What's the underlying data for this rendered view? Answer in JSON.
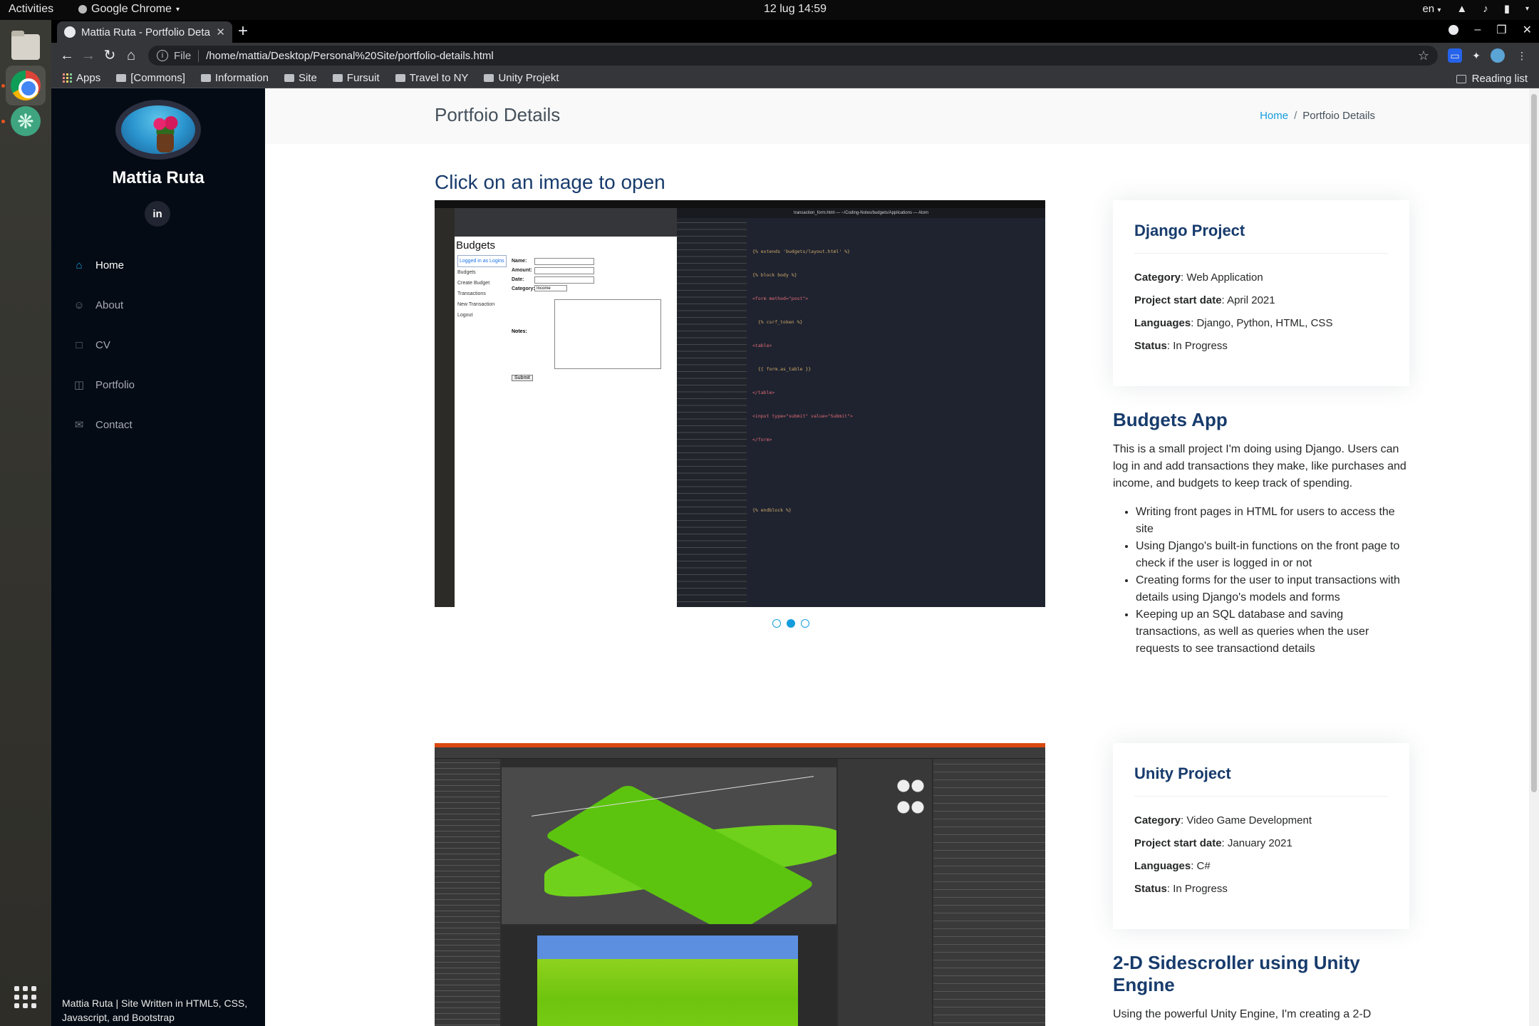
{
  "system": {
    "activities": "Activities",
    "app_name": "Google Chrome",
    "clock": "12 lug  14:59",
    "lang": "en"
  },
  "browser": {
    "tab_title": "Mattia Ruta - Portfolio Details",
    "scheme": "File",
    "url": "/home/mattia/Desktop/Personal%20Site/portfolio-details.html",
    "bookmarks": [
      "Apps",
      "[Commons]",
      "Information",
      "Site",
      "Fursuit",
      "Travel to NY",
      "Unity Projekt"
    ],
    "reading_list": "Reading list"
  },
  "sidebar": {
    "name": "Mattia Ruta",
    "social": "in",
    "nav": [
      "Home",
      "About",
      "CV",
      "Portfolio",
      "Contact"
    ],
    "footer": "Mattia Ruta | Site Written in HTML5, CSS, Javascript, and Bootstrap"
  },
  "breadcrumbs": {
    "title": "Portfoio Details",
    "home": "Home",
    "sep": "/",
    "current": "Portfoio Details"
  },
  "content": {
    "hint": "Click on an image to open",
    "slider_count": 3,
    "slider_active_index": 1
  },
  "projects": [
    {
      "card_title": "Django Project",
      "category_label": "Category",
      "category": "Web Application",
      "date_label": "Project start date",
      "date": "April 2021",
      "languages_label": "Languages",
      "languages": "Django, Python, HTML, CSS",
      "status_label": "Status",
      "status": "In Progress",
      "title": "Budgets App",
      "description": "This is a small project I'm doing using Django. Users can log in and add transactions they make, like purchases and income, and budgets to keep track of spending.",
      "bullets": [
        "Writing front pages in HTML for users to access the site",
        "Using Django's built-in functions on the front page to check if the user is logged in or not",
        "Creating forms for the user to input transactions with details using Django's models and forms",
        "Keeping up an SQL database and saving transactions, as well as queries when the user requests to see transactiond details"
      ]
    },
    {
      "card_title": "Unity Project",
      "category_label": "Category",
      "category": "Video Game Development",
      "date_label": "Project start date",
      "date": "January 2021",
      "languages_label": "Languages",
      "languages": "C#",
      "status_label": "Status",
      "status": "In Progress",
      "title": "2-D Sidescroller using Unity Engine",
      "description": "Using the powerful Unity Engine, I'm creating a 2-D"
    }
  ],
  "screenshot1": {
    "page_heading": "Budgets",
    "links": [
      "Logged in as Logins",
      "Budgets",
      "Create Budget",
      "Transactions",
      "New Transaction",
      "Logout"
    ],
    "form_labels": [
      "Name:",
      "Amount:",
      "Date:",
      "Category:",
      "Notes:"
    ],
    "category_value": "Income",
    "submit": "Submit",
    "editor_title": "transaction_form.html — ~/Coding-Notes/budgets/Applications — Atom",
    "code": [
      "{% extends 'budgets/layout.html' %}",
      "{% block body %}",
      "<form method=\"post\">",
      "  {% csrf_token %}",
      "<table>",
      "  {{ form.as_table }}",
      "</table>",
      "<input type=\"submit\" value=\"Submit\">",
      "</form>",
      "",
      "",
      "",
      "{% endblock %}"
    ]
  }
}
